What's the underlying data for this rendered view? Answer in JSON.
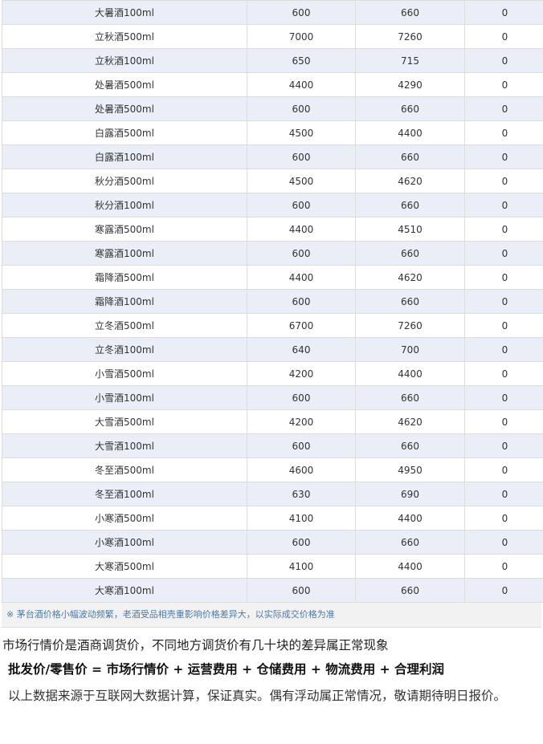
{
  "rows": [
    {
      "name": "大暑酒100ml",
      "wholesale": "600",
      "retail": "660",
      "change": "0"
    },
    {
      "name": "立秋酒500ml",
      "wholesale": "7000",
      "retail": "7260",
      "change": "0"
    },
    {
      "name": "立秋酒100ml",
      "wholesale": "650",
      "retail": "715",
      "change": "0"
    },
    {
      "name": "处暑酒500ml",
      "wholesale": "4400",
      "retail": "4290",
      "change": "0"
    },
    {
      "name": "处暑酒500ml",
      "wholesale": "600",
      "retail": "660",
      "change": "0"
    },
    {
      "name": "白露酒500ml",
      "wholesale": "4500",
      "retail": "4400",
      "change": "0"
    },
    {
      "name": "白露酒100ml",
      "wholesale": "600",
      "retail": "660",
      "change": "0"
    },
    {
      "name": "秋分酒500ml",
      "wholesale": "4500",
      "retail": "4620",
      "change": "0"
    },
    {
      "name": "秋分酒100ml",
      "wholesale": "600",
      "retail": "660",
      "change": "0"
    },
    {
      "name": "寒露酒500ml",
      "wholesale": "4400",
      "retail": "4510",
      "change": "0"
    },
    {
      "name": "寒露酒100ml",
      "wholesale": "600",
      "retail": "660",
      "change": "0"
    },
    {
      "name": "霜降酒500ml",
      "wholesale": "4400",
      "retail": "4620",
      "change": "0"
    },
    {
      "name": "霜降酒100ml",
      "wholesale": "600",
      "retail": "660",
      "change": "0"
    },
    {
      "name": "立冬酒500ml",
      "wholesale": "6700",
      "retail": "7260",
      "change": "0"
    },
    {
      "name": "立冬酒100ml",
      "wholesale": "640",
      "retail": "700",
      "change": "0"
    },
    {
      "name": "小雪酒500ml",
      "wholesale": "4200",
      "retail": "4400",
      "change": "0"
    },
    {
      "name": "小雪酒100ml",
      "wholesale": "600",
      "retail": "660",
      "change": "0"
    },
    {
      "name": "大雪酒500ml",
      "wholesale": "4200",
      "retail": "4620",
      "change": "0"
    },
    {
      "name": "大雪酒100ml",
      "wholesale": "600",
      "retail": "660",
      "change": "0"
    },
    {
      "name": "冬至酒500ml",
      "wholesale": "4600",
      "retail": "4950",
      "change": "0"
    },
    {
      "name": "冬至酒100ml",
      "wholesale": "630",
      "retail": "690",
      "change": "0"
    },
    {
      "name": "小寒酒500ml",
      "wholesale": "4100",
      "retail": "4400",
      "change": "0"
    },
    {
      "name": "小寒酒100ml",
      "wholesale": "600",
      "retail": "660",
      "change": "0"
    },
    {
      "name": "大寒酒500ml",
      "wholesale": "4100",
      "retail": "4400",
      "change": "0"
    },
    {
      "name": "大寒酒100ml",
      "wholesale": "600",
      "retail": "660",
      "change": "0"
    }
  ],
  "note": "※ 茅台酒价格小幅波动频繁，老酒受品相壳重影响价格差异大，以实际成交价格为准",
  "text": {
    "market": "市场行情价是酒商调货价，不同地方调货价有几十块的差异属正常现象",
    "formula": "批发价/零售价 = 市场行情价 + 运营费用 + 仓储费用 + 物流费用 + 合理利润",
    "source": "以上数据来源于互联网大数据计算，保证真实。偶有浮动属正常情况，敬请期待明日报价。"
  }
}
